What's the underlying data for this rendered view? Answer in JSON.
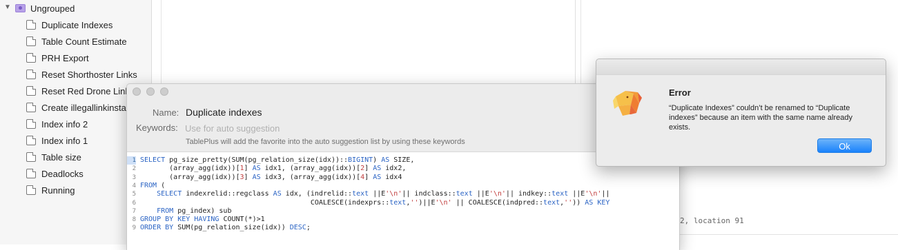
{
  "sidebar": {
    "group": {
      "label": "Ungrouped",
      "folder_color": "#b8a2e8"
    },
    "items": [
      {
        "label": "Duplicate Indexes"
      },
      {
        "label": "Table Count Estimate"
      },
      {
        "label": "PRH Export"
      },
      {
        "label": "Reset Shorthoster Links"
      },
      {
        "label": "Reset Red Drone Links"
      },
      {
        "label": "Create illegallinkinstar"
      },
      {
        "label": "Index info 2"
      },
      {
        "label": "Index info 1"
      },
      {
        "label": "Table size"
      },
      {
        "label": "Deadlocks"
      },
      {
        "label": "Running"
      }
    ]
  },
  "edit_favorite": {
    "name_label": "Name:",
    "name_value": "Duplicate indexes",
    "keywords_label": "Keywords:",
    "keywords_placeholder": "Use for auto suggestion",
    "hint": "TablePlus will add the favorite into the auto suggestion list by using these keywords",
    "code_lines": [
      {
        "n": "1",
        "tokens": [
          {
            "t": "SELECT",
            "c": "kw"
          },
          {
            "t": " pg_size_pretty(SUM(pg_relation_size(idx))::"
          },
          {
            "t": "BIGINT",
            "c": "kw"
          },
          {
            "t": ") "
          },
          {
            "t": "AS",
            "c": "kw"
          },
          {
            "t": " SIZE,"
          }
        ]
      },
      {
        "n": "2",
        "tokens": [
          {
            "t": "       (array_agg(idx))["
          },
          {
            "t": "1",
            "c": "num"
          },
          {
            "t": "] "
          },
          {
            "t": "AS",
            "c": "kw"
          },
          {
            "t": " idx1, (array_agg(idx))["
          },
          {
            "t": "2",
            "c": "num"
          },
          {
            "t": "] "
          },
          {
            "t": "AS",
            "c": "kw"
          },
          {
            "t": " idx2,"
          }
        ]
      },
      {
        "n": "3",
        "tokens": [
          {
            "t": "       (array_agg(idx))["
          },
          {
            "t": "3",
            "c": "num"
          },
          {
            "t": "] "
          },
          {
            "t": "AS",
            "c": "kw"
          },
          {
            "t": " idx3, (array_agg(idx))["
          },
          {
            "t": "4",
            "c": "num"
          },
          {
            "t": "] "
          },
          {
            "t": "AS",
            "c": "kw"
          },
          {
            "t": " idx4"
          }
        ]
      },
      {
        "n": "4",
        "tokens": [
          {
            "t": "FROM",
            "c": "kw"
          },
          {
            "t": " ("
          }
        ]
      },
      {
        "n": "5",
        "tokens": [
          {
            "t": "    "
          },
          {
            "t": "SELECT",
            "c": "kw"
          },
          {
            "t": " indexrelid::regclass "
          },
          {
            "t": "AS",
            "c": "kw"
          },
          {
            "t": " idx, (indrelid::"
          },
          {
            "t": "text",
            "c": "kw"
          },
          {
            "t": " ||E"
          },
          {
            "t": "'\\n'",
            "c": "str"
          },
          {
            "t": "|| indclass::"
          },
          {
            "t": "text",
            "c": "kw"
          },
          {
            "t": " ||E"
          },
          {
            "t": "'\\n'",
            "c": "str"
          },
          {
            "t": "|| indkey::"
          },
          {
            "t": "text",
            "c": "kw"
          },
          {
            "t": " ||E"
          },
          {
            "t": "'\\n'",
            "c": "str"
          },
          {
            "t": "||"
          }
        ]
      },
      {
        "n": "6",
        "tokens": [
          {
            "t": "                                         COALESCE(indexprs::"
          },
          {
            "t": "text",
            "c": "kw"
          },
          {
            "t": ","
          },
          {
            "t": "''",
            "c": "str"
          },
          {
            "t": ")||E"
          },
          {
            "t": "'\\n'",
            "c": "str"
          },
          {
            "t": " || COALESCE(indpred::"
          },
          {
            "t": "text",
            "c": "kw"
          },
          {
            "t": ","
          },
          {
            "t": "''",
            "c": "str"
          },
          {
            "t": ")) "
          },
          {
            "t": "AS",
            "c": "kw"
          },
          {
            "t": " "
          },
          {
            "t": "KEY",
            "c": "kw"
          }
        ]
      },
      {
        "n": "7",
        "tokens": [
          {
            "t": "    "
          },
          {
            "t": "FROM",
            "c": "kw"
          },
          {
            "t": " pg_index) sub"
          }
        ]
      },
      {
        "n": "8",
        "tokens": [
          {
            "t": "GROUP BY",
            "c": "kw"
          },
          {
            "t": " "
          },
          {
            "t": "KEY",
            "c": "kw"
          },
          {
            "t": " "
          },
          {
            "t": "HAVING",
            "c": "kw"
          },
          {
            "t": " COUNT(*)>1"
          }
        ]
      },
      {
        "n": "9",
        "tokens": [
          {
            "t": "ORDER BY",
            "c": "kw"
          },
          {
            "t": " SUM(pg_relation_size(idx)) "
          },
          {
            "t": "DESC",
            "c": "kw"
          },
          {
            "t": ";"
          }
        ]
      }
    ]
  },
  "error_dialog": {
    "title": "Error",
    "message": "“Duplicate Indexes” couldn’t be renamed to “Duplicate indexes” because an item with the same name already exists.",
    "ok_label": "Ok",
    "app_icon": "tableplus-elephant-icon"
  },
  "status": {
    "text": "2, location 91"
  },
  "colors": {
    "accent": "#1a82fb",
    "keyword": "#2a63c4",
    "literal": "#c13c3c"
  }
}
